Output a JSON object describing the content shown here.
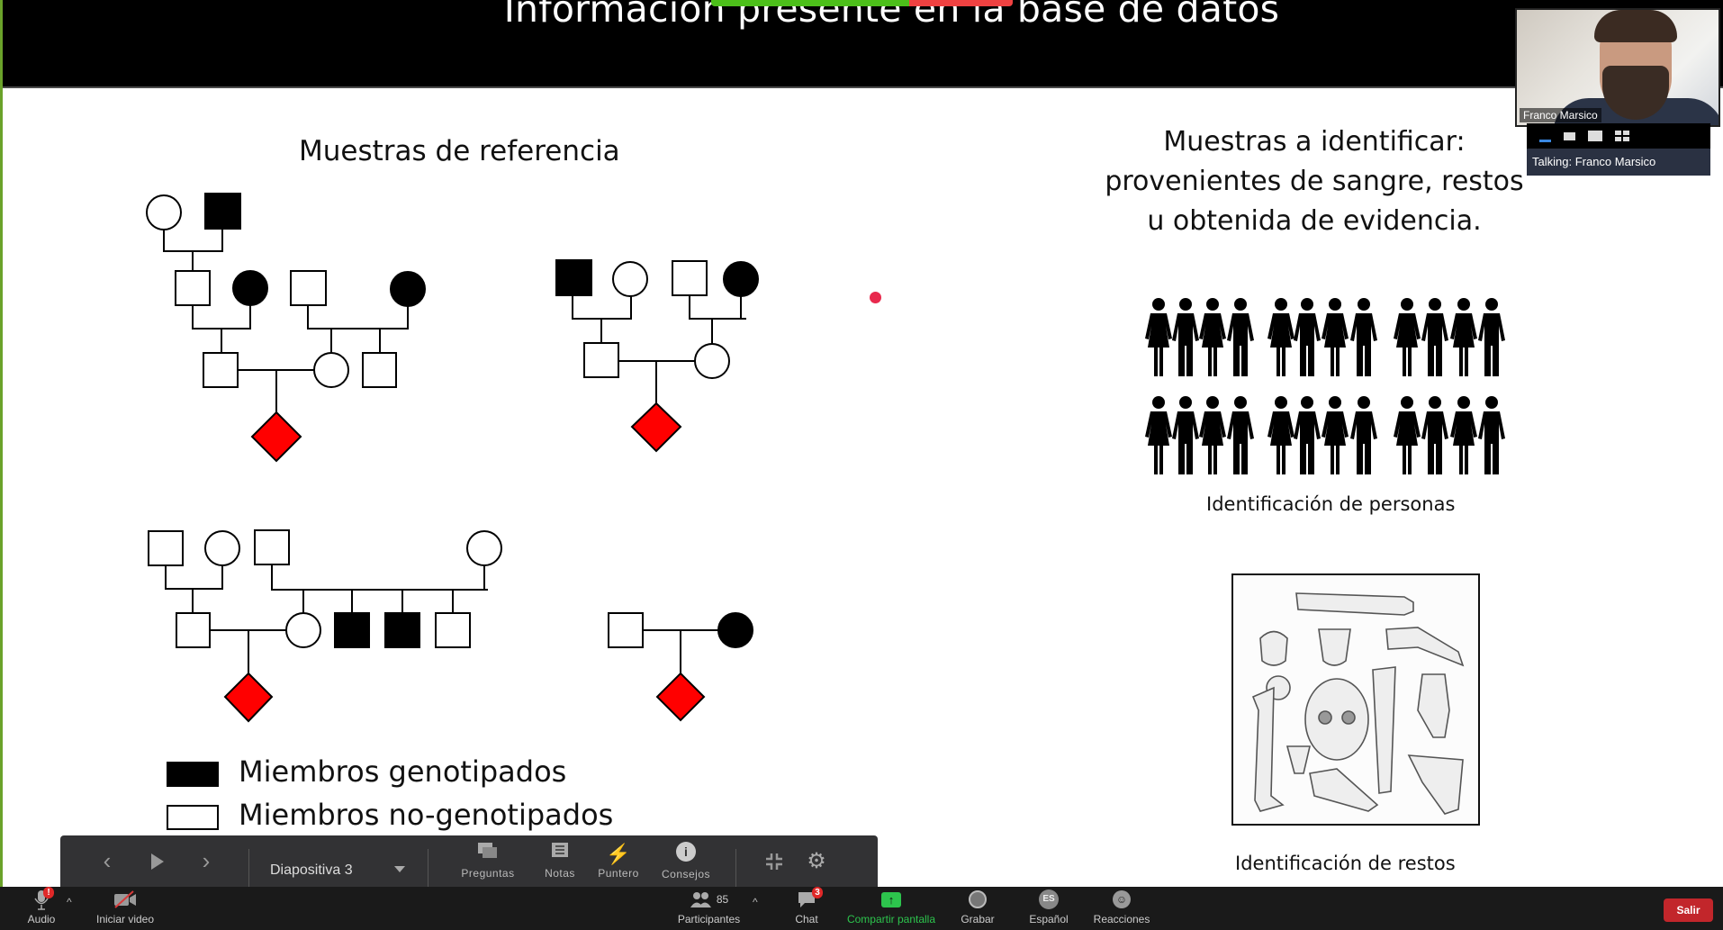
{
  "slide": {
    "title": "Información presente en la base de datos",
    "left_heading": "Muestras de referencia",
    "right_heading_lines": [
      "Muestras a identificar:",
      "provenientes de sangre, restos",
      "u obtenida de evidencia."
    ],
    "persons_caption": "Identificación de personas",
    "persons_rows": 2,
    "persons_per_row": 12,
    "remains_caption": "Identificación de restos",
    "bones_image_alt": "bones-illustration",
    "legend": [
      {
        "label": "Miembros genotipados",
        "fill": "#000000"
      },
      {
        "label": "Miembros no-genotipados",
        "fill": "#ffffff"
      }
    ],
    "colors": {
      "target": "#ff0000",
      "genotyped": "#000000",
      "line": "#000000",
      "laser": "#e8294d"
    },
    "pedigrees": [
      {
        "name": "pedigree-1",
        "members": 10,
        "genotyped": 3,
        "targets": 1
      },
      {
        "name": "pedigree-2",
        "members": 7,
        "genotyped": 2,
        "targets": 1
      },
      {
        "name": "pedigree-3",
        "members": 10,
        "genotyped": 2,
        "targets": 1
      },
      {
        "name": "pedigree-4",
        "members": 3,
        "genotyped": 1,
        "targets": 1
      }
    ]
  },
  "video": {
    "participant_name": "Franco Marsico",
    "talking_label": "Talking: Franco Marsico"
  },
  "presenter_toolbar": {
    "slide_label": "Diapositiva 3",
    "prev_icon": "chevron-left-icon",
    "play_icon": "play-icon",
    "next_icon": "chevron-right-icon",
    "tools": [
      {
        "label": "Preguntas",
        "icon": "questions-icon"
      },
      {
        "label": "Notas",
        "icon": "notes-icon"
      },
      {
        "label": "Puntero",
        "icon": "laser-pointer-icon"
      },
      {
        "label": "Consejos",
        "icon": "info-icon"
      }
    ]
  },
  "zoom_bar": {
    "audio_label": "Audio",
    "video_label": "Iniciar video",
    "participants_label": "Participantes",
    "participants_count": "85",
    "chat_label": "Chat",
    "chat_badge": "3",
    "share_label": "Compartir pantalla",
    "record_label": "Grabar",
    "language_label": "Español",
    "language_code": "ES",
    "reactions_label": "Reacciones",
    "leave_label": "Salir",
    "share_color": "#2dc44d",
    "leave_color": "#c2262b"
  }
}
